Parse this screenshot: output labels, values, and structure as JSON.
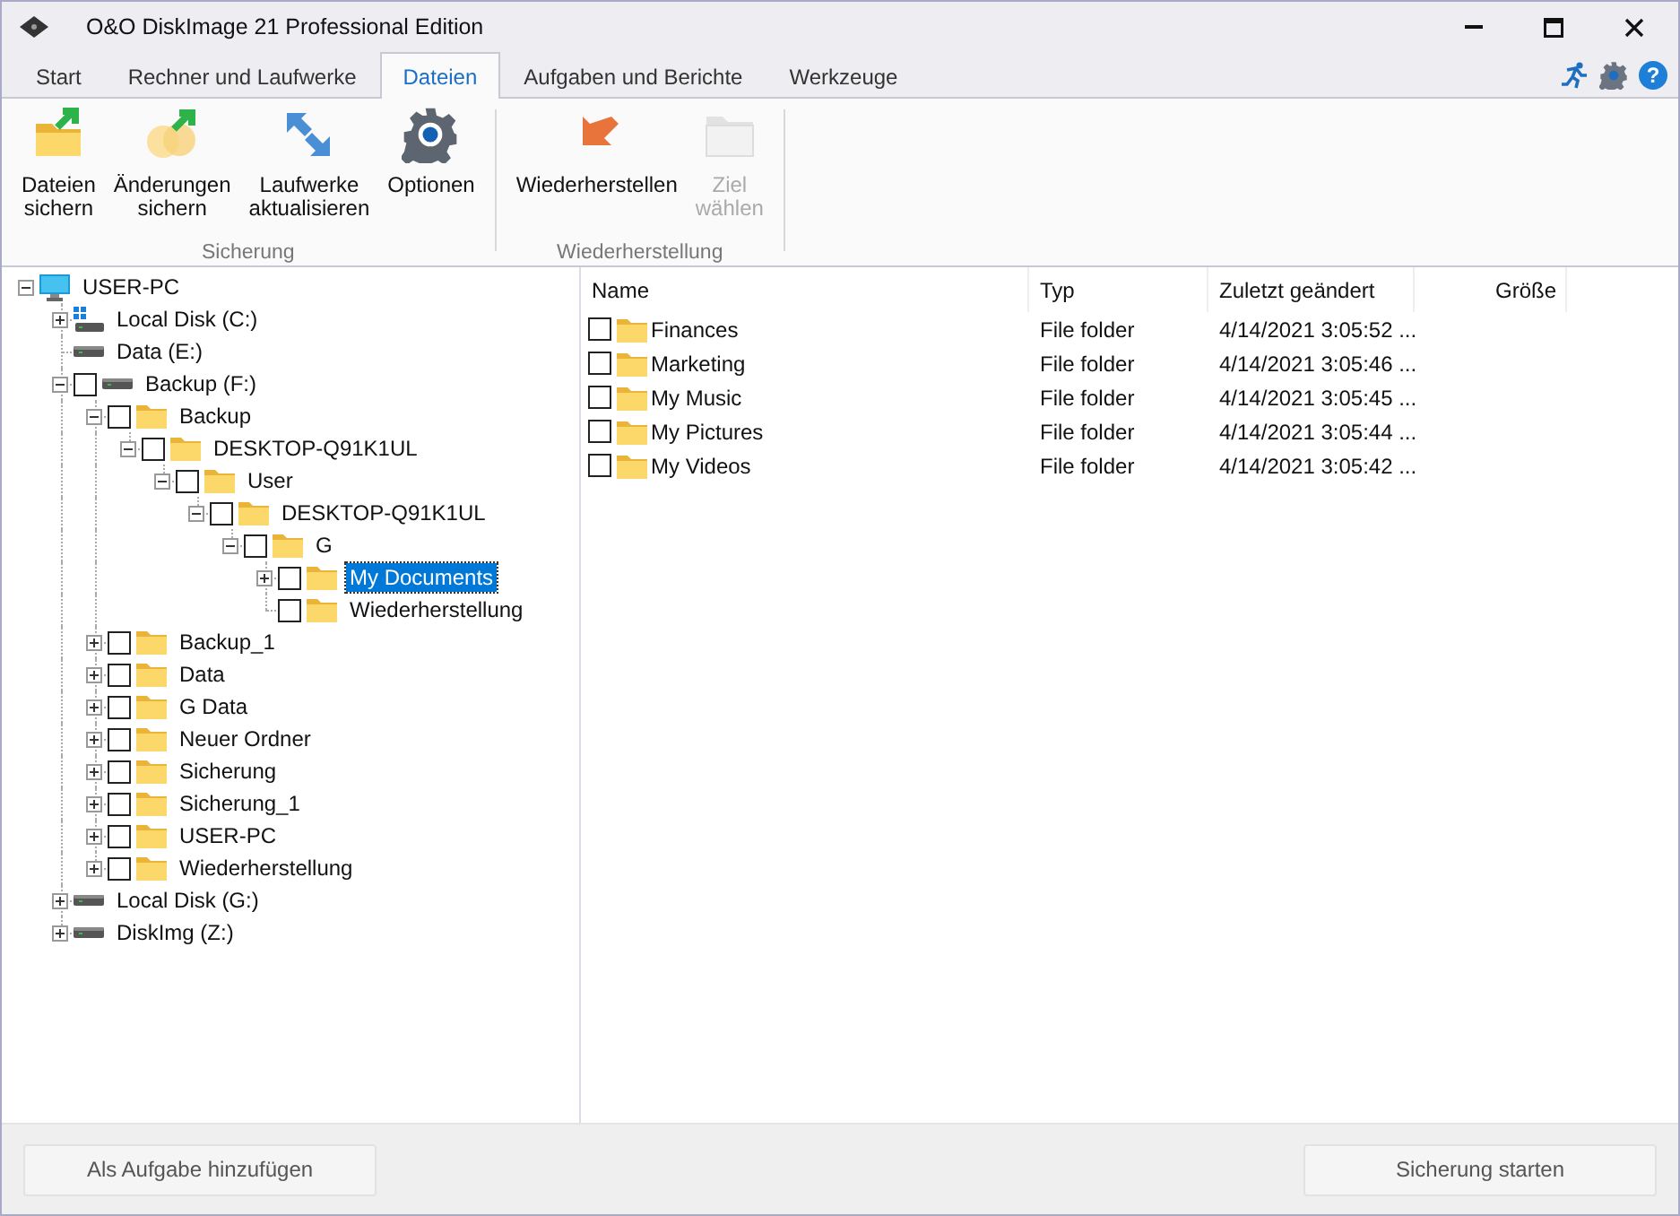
{
  "window": {
    "title": "O&O DiskImage 21 Professional Edition"
  },
  "tabs": [
    {
      "label": "Start",
      "selected": false
    },
    {
      "label": "Rechner und Laufwerke",
      "selected": false
    },
    {
      "label": "Dateien",
      "selected": true
    },
    {
      "label": "Aufgaben und Berichte",
      "selected": false
    },
    {
      "label": "Werkzeuge",
      "selected": false
    }
  ],
  "help_label": "?",
  "ribbon": {
    "groups": [
      {
        "label": "Sicherung",
        "buttons": [
          {
            "kind": "backup-files",
            "label": "Dateien\nsichern",
            "disabled": false
          },
          {
            "kind": "backup-changes",
            "label": "Änderungen\nsichern",
            "disabled": false
          },
          {
            "kind": "refresh-drives",
            "label": "Laufwerke\naktualisieren",
            "disabled": false
          },
          {
            "kind": "options",
            "label": "Optionen",
            "disabled": false
          }
        ]
      },
      {
        "label": "Wiederherstellung",
        "buttons": [
          {
            "kind": "restore",
            "label": "Wiederherstellen",
            "disabled": false
          },
          {
            "kind": "target",
            "label": "Ziel\nwählen",
            "disabled": true
          }
        ]
      }
    ]
  },
  "tree": {
    "items": [
      {
        "kind": "computer",
        "label": "USER-PC",
        "expanded": true,
        "selected": false,
        "children": [
          {
            "kind": "system-drive",
            "label": "Local Disk (C:)",
            "expanded": false,
            "selected": false
          },
          {
            "kind": "drive",
            "label": "Data (E:)",
            "selected": false
          },
          {
            "kind": "drive",
            "label": "Backup (F:)",
            "expanded": true,
            "checked": false,
            "selected": false,
            "children": [
              {
                "kind": "folder",
                "label": "Backup",
                "expanded": true,
                "checked": false,
                "selected": false,
                "children": [
                  {
                    "kind": "folder",
                    "label": "DESKTOP-Q91K1UL",
                    "expanded": true,
                    "checked": false,
                    "selected": false,
                    "children": [
                      {
                        "kind": "folder",
                        "label": "User",
                        "expanded": true,
                        "checked": false,
                        "selected": false,
                        "children": [
                          {
                            "kind": "folder",
                            "label": "DESKTOP-Q91K1UL",
                            "expanded": true,
                            "checked": false,
                            "selected": false,
                            "children": [
                              {
                                "kind": "folder",
                                "label": "G",
                                "expanded": true,
                                "checked": false,
                                "selected": false,
                                "children": [
                                  {
                                    "kind": "folder",
                                    "label": "My Documents",
                                    "expanded": false,
                                    "checked": false,
                                    "selected": true
                                  },
                                  {
                                    "kind": "folder",
                                    "label": "Wiederherstellung",
                                    "checked": false,
                                    "selected": false
                                  }
                                ]
                              }
                            ]
                          }
                        ]
                      }
                    ]
                  }
                ]
              },
              {
                "kind": "folder",
                "label": "Backup_1",
                "expanded": false,
                "checked": false,
                "selected": false
              },
              {
                "kind": "folder",
                "label": "Data",
                "expanded": false,
                "checked": false,
                "selected": false
              },
              {
                "kind": "folder",
                "label": "G Data",
                "expanded": false,
                "checked": false,
                "selected": false
              },
              {
                "kind": "folder",
                "label": "Neuer Ordner",
                "expanded": false,
                "checked": false,
                "selected": false
              },
              {
                "kind": "folder",
                "label": "Sicherung",
                "expanded": false,
                "checked": false,
                "selected": false
              },
              {
                "kind": "folder",
                "label": "Sicherung_1",
                "expanded": false,
                "checked": false,
                "selected": false
              },
              {
                "kind": "folder",
                "label": "USER-PC",
                "expanded": false,
                "checked": false,
                "selected": false
              },
              {
                "kind": "folder",
                "label": "Wiederherstellung",
                "expanded": false,
                "checked": false,
                "selected": false
              }
            ]
          },
          {
            "kind": "drive",
            "label": "Local Disk (G:)",
            "expanded": false,
            "selected": false
          },
          {
            "kind": "drive",
            "label": "DiskImg (Z:)",
            "expanded": false,
            "selected": false
          }
        ]
      }
    ]
  },
  "file_list": {
    "columns": [
      "Name",
      "Typ",
      "Zuletzt geändert",
      "Größe"
    ],
    "rows": [
      {
        "name": "Finances",
        "type": "File folder",
        "modified": "4/14/2021 3:05:52 ...",
        "checked": false
      },
      {
        "name": "Marketing",
        "type": "File folder",
        "modified": "4/14/2021 3:05:46 ...",
        "checked": false
      },
      {
        "name": "My Music",
        "type": "File folder",
        "modified": "4/14/2021 3:05:45 ...",
        "checked": false
      },
      {
        "name": "My Pictures",
        "type": "File folder",
        "modified": "4/14/2021 3:05:44 ...",
        "checked": false
      },
      {
        "name": "My Videos",
        "type": "File folder",
        "modified": "4/14/2021 3:05:42 ...",
        "checked": false
      }
    ]
  },
  "footer": {
    "buttons": [
      "Als Aufgabe hinzufügen",
      "Sicherung starten"
    ]
  }
}
